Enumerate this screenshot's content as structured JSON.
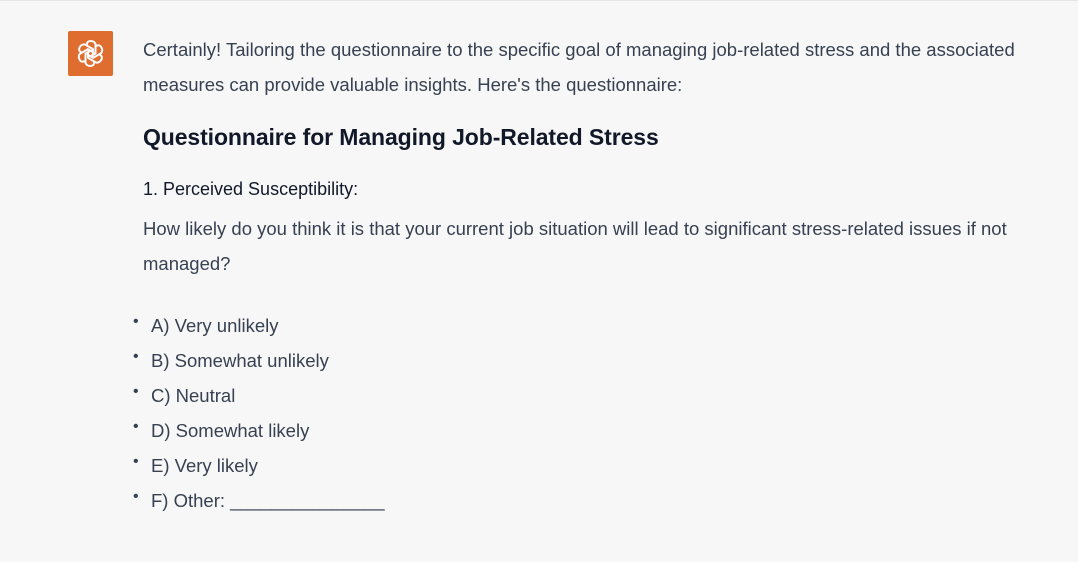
{
  "colors": {
    "avatar_bg": "#df6d2f",
    "background": "#f7f7f8",
    "text": "#374151",
    "heading": "#111827"
  },
  "assistant_avatar": {
    "icon": "openai-logo-icon"
  },
  "message": {
    "intro": "Certainly! Tailoring the questionnaire to the specific goal of managing job-related stress and the associated measures can provide valuable insights. Here's the questionnaire:",
    "heading": "Questionnaire for Managing Job-Related Stress",
    "section_title": "1. Perceived Susceptibility:",
    "question": "How likely do you think it is that your current job situation will lead to significant stress-related issues if not managed?",
    "options": [
      "A) Very unlikely",
      "B) Somewhat unlikely",
      "C) Neutral",
      "D) Somewhat likely",
      "E) Very likely",
      "F) Other: _______________"
    ]
  }
}
